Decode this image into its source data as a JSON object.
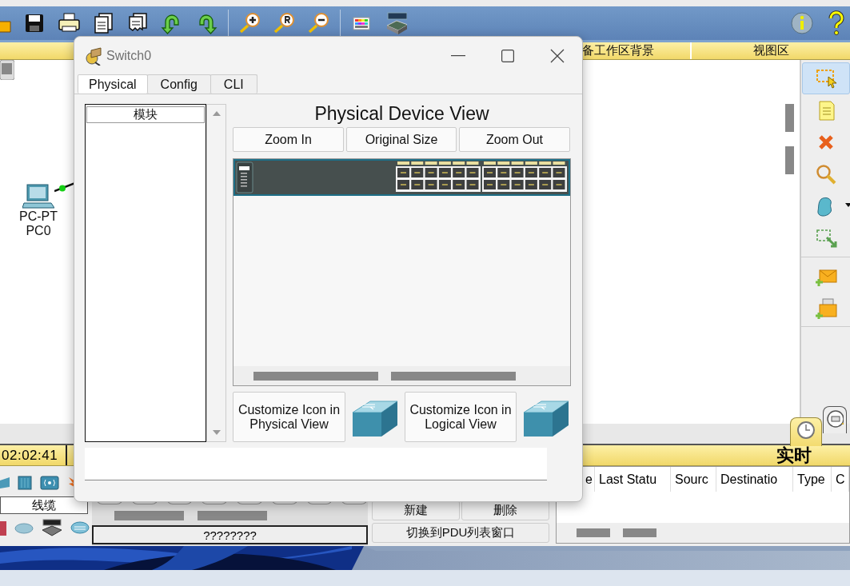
{
  "workspace_header": [
    {
      "label": "备工作区背景"
    },
    {
      "label": "视图区"
    }
  ],
  "canvas": {
    "devices": [
      {
        "model": "PC-PT",
        "name": "PC0"
      }
    ]
  },
  "tool_palette": [
    {
      "kind": "select",
      "selected": true
    },
    {
      "kind": "note",
      "selected": false
    },
    {
      "kind": "delete",
      "selected": false
    },
    {
      "kind": "inspect",
      "selected": false
    },
    {
      "kind": "shape",
      "selected": false
    },
    {
      "kind": "resize",
      "selected": false
    },
    {
      "kind": "simple-pdu",
      "selected": false
    },
    {
      "kind": "complex-pdu",
      "selected": false
    }
  ],
  "clock": "02:02:41",
  "mode_label": "实时",
  "device_category": "线缆",
  "device_model_label": "????????",
  "pdu_buttons": [
    "新建",
    "删除",
    "切换到PDU列表窗口"
  ],
  "pdu_table": {
    "columns": [
      "e",
      "Last Statu",
      "Sourc",
      "Destinatio",
      "Type",
      "C"
    ]
  },
  "dialog": {
    "title": "Switch0",
    "tabs": [
      {
        "label": "Physical",
        "selected": true
      },
      {
        "label": "Config",
        "selected": false
      },
      {
        "label": "CLI",
        "selected": false
      }
    ],
    "module_list": {
      "header": "模块"
    },
    "device_view": {
      "title": "Physical Device View",
      "buttons": [
        "Zoom In",
        "Original Size",
        "Zoom Out"
      ]
    },
    "customize_buttons": [
      "Customize Icon in Physical View",
      "Customize Icon in Logical View"
    ]
  }
}
